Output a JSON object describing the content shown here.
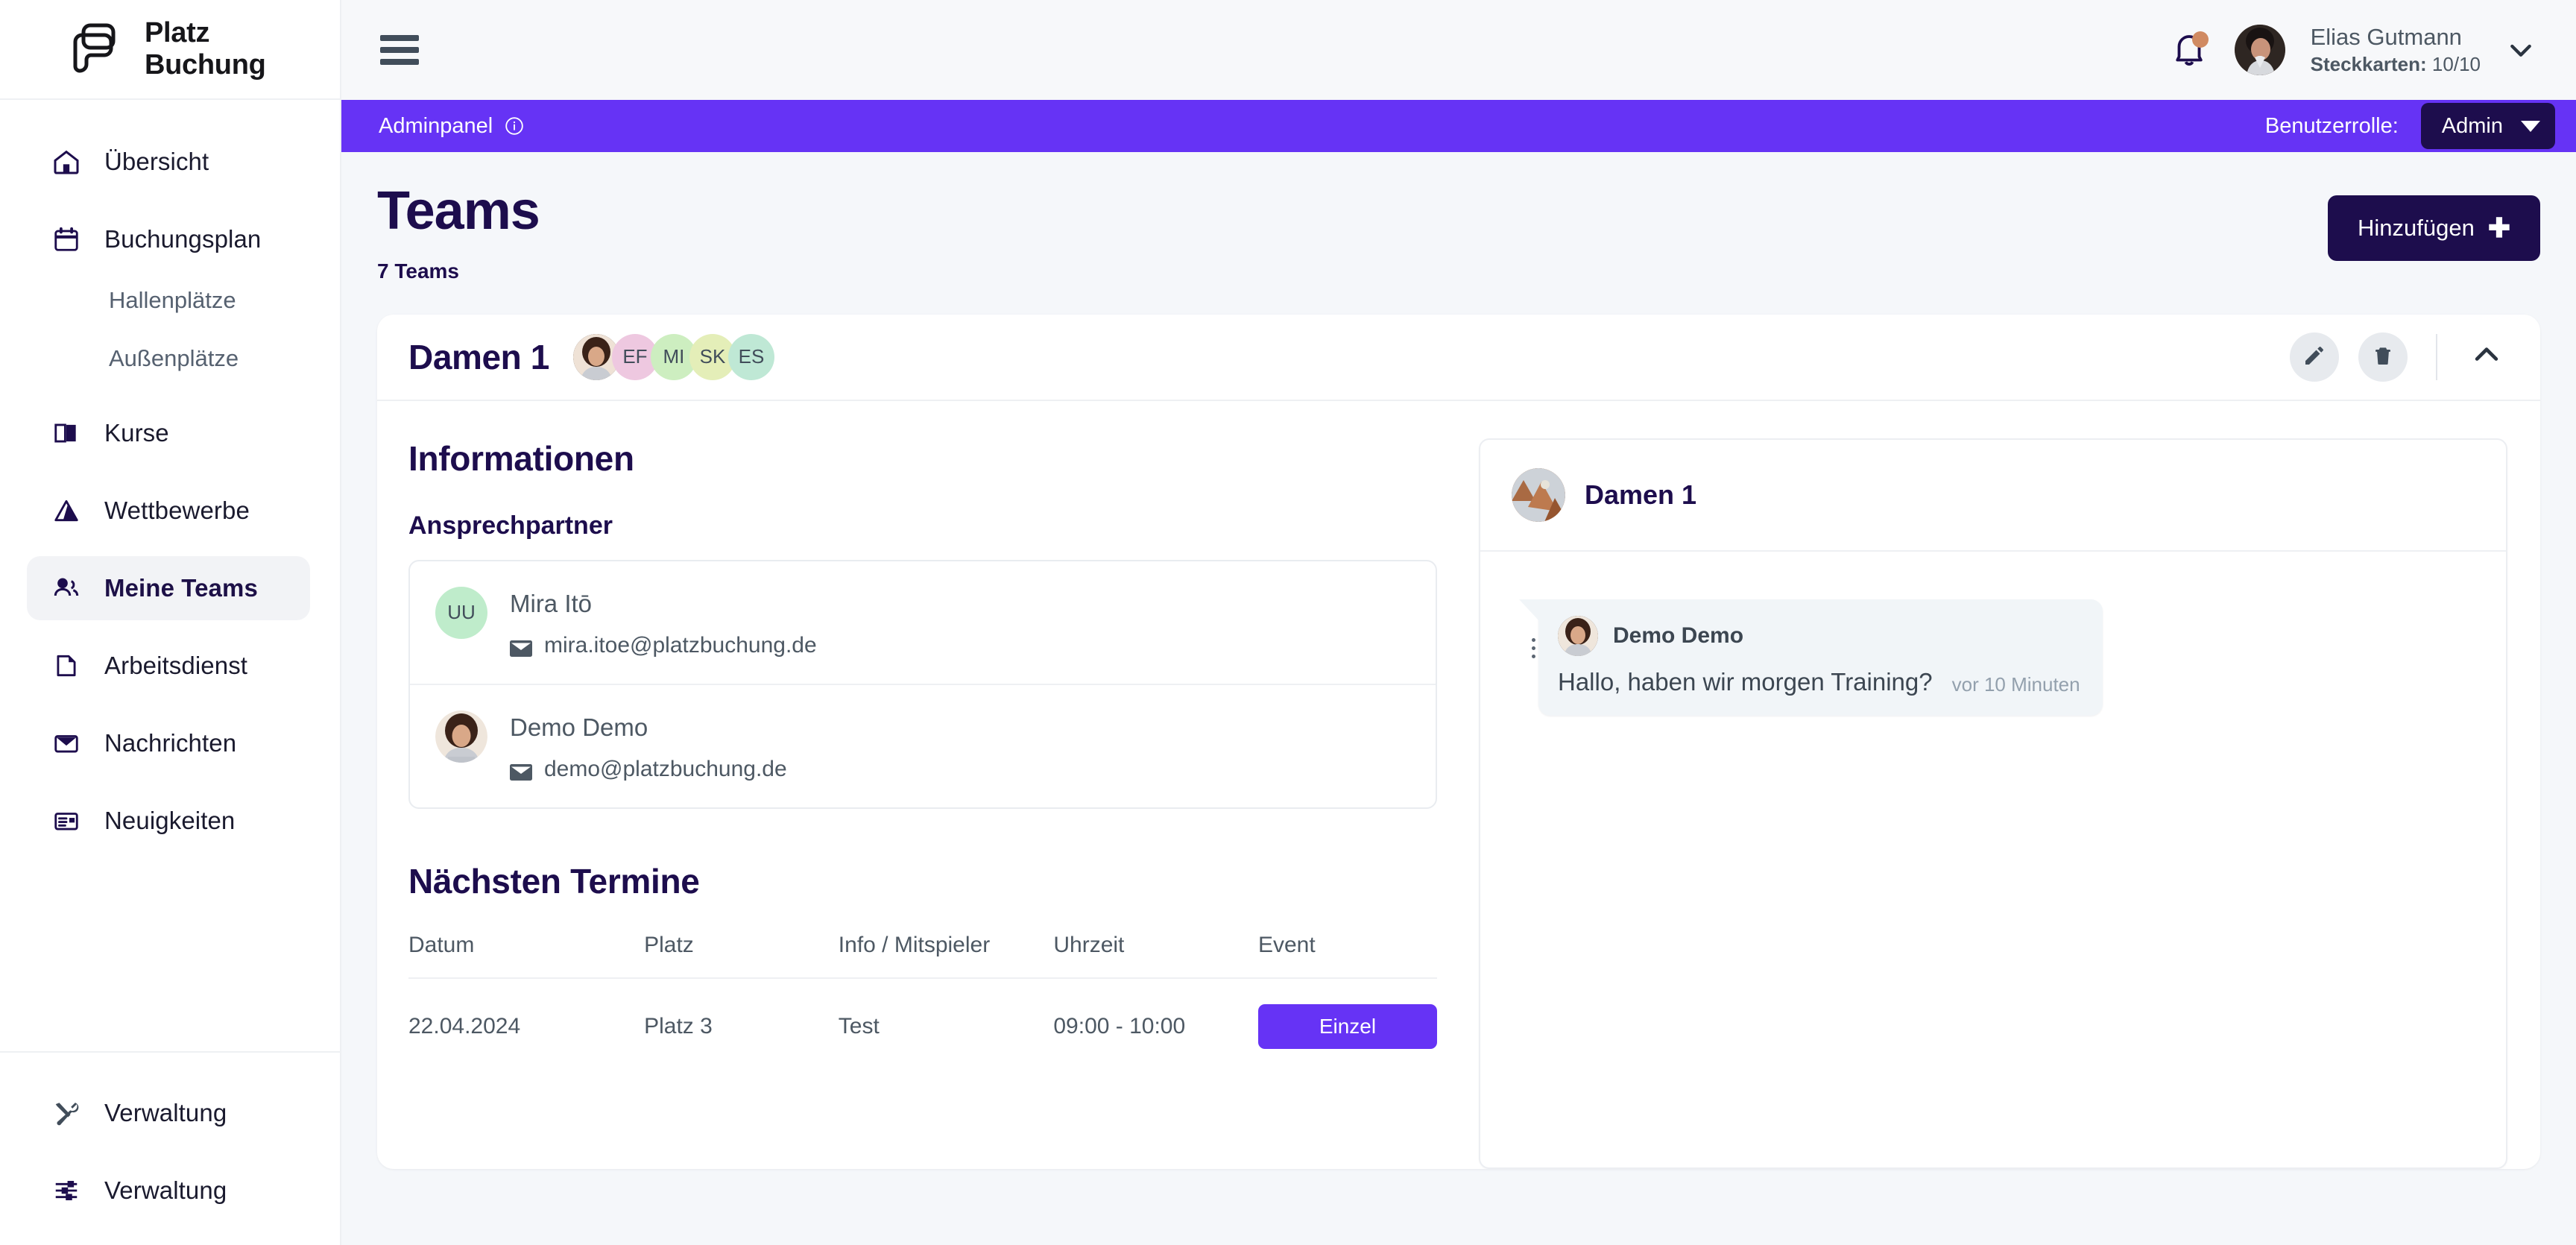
{
  "brand": {
    "line1": "Platz",
    "line2": "Buchung",
    "logo_icon": "platz-buchung-logo"
  },
  "sidebar": {
    "items": [
      {
        "label": "Übersicht",
        "icon": "home-icon",
        "type": "item",
        "active": false
      },
      {
        "label": "Buchungsplan",
        "icon": "calendar-icon",
        "type": "item",
        "active": false
      },
      {
        "label": "Hallenplätze",
        "icon": "",
        "type": "sub",
        "active": false
      },
      {
        "label": "Außenplätze",
        "icon": "",
        "type": "sub",
        "active": false
      },
      {
        "label": "Kurse",
        "icon": "book-icon",
        "type": "item",
        "active": false
      },
      {
        "label": "Wettbewerbe",
        "icon": "trophy-icon",
        "type": "item",
        "active": false
      },
      {
        "label": "Meine Teams",
        "icon": "users-icon",
        "type": "item",
        "active": true
      },
      {
        "label": "Arbeitsdienst",
        "icon": "file-icon",
        "type": "item",
        "active": false
      },
      {
        "label": "Nachrichten",
        "icon": "envelope-icon",
        "type": "item",
        "active": false
      },
      {
        "label": "Neuigkeiten",
        "icon": "news-icon",
        "type": "item",
        "active": false
      }
    ],
    "bottom_items": [
      {
        "label": "Verwaltung",
        "icon": "tools-icon"
      },
      {
        "label": "Verwaltung",
        "icon": "sliders-icon"
      }
    ]
  },
  "topbar": {
    "menu_icon": "hamburger-icon",
    "bell_icon": "bell-icon",
    "has_notification": true,
    "user_name": "Elias Gutmann",
    "user_sub_label": "Steckkarten:",
    "user_sub_value": "10/10",
    "chevron_icon": "chevron-down-icon"
  },
  "adminbar": {
    "title": "Adminpanel",
    "info_icon": "info-circle-icon",
    "role_label": "Benutzerrolle:",
    "role_value": "Admin",
    "bg_color": "#6633f5",
    "select_bg": "#1d0d4d"
  },
  "page": {
    "title": "Teams",
    "count": "7 Teams",
    "add_button": "Hinzufügen",
    "add_icon": "plus-icon"
  },
  "team": {
    "name": "Damen 1",
    "members": [
      {
        "initials": "",
        "color": "#6b5a4e",
        "photo": true
      },
      {
        "initials": "EF",
        "color": "#eec8e0",
        "photo": false
      },
      {
        "initials": "MI",
        "color": "#cdeec0",
        "photo": false
      },
      {
        "initials": "SK",
        "color": "#e4eeb8",
        "photo": false
      },
      {
        "initials": "ES",
        "color": "#bfe8d5",
        "photo": false
      }
    ],
    "edit_icon": "pencil-icon",
    "delete_icon": "trash-icon",
    "collapse_icon": "chevron-up-icon",
    "info_heading": "Informationen",
    "contact_heading": "Ansprechpartner",
    "contacts": [
      {
        "name": "Mira Itō",
        "email": "mira.itoe@platzbuchung.de",
        "initials": "UU",
        "color": "#bfeccb",
        "photo": false
      },
      {
        "name": "Demo Demo",
        "email": "demo@platzbuchung.de",
        "initials": "",
        "color": "#6b5a4e",
        "photo": true
      }
    ],
    "appointments_heading": "Nächsten Termine",
    "table": {
      "headers": [
        "Datum",
        "Platz",
        "Info / Mitspieler",
        "Uhrzeit",
        "Event"
      ],
      "rows": [
        {
          "datum": "22.04.2024",
          "platz": "Platz 3",
          "info": "Test",
          "uhrzeit": "09:00 - 10:00",
          "event": "Einzel"
        }
      ]
    }
  },
  "chat": {
    "title": "Damen 1",
    "messages": [
      {
        "author": "Demo Demo",
        "text": "Hallo, haben wir morgen Training?",
        "time": "vor 10 Minuten"
      }
    ]
  }
}
